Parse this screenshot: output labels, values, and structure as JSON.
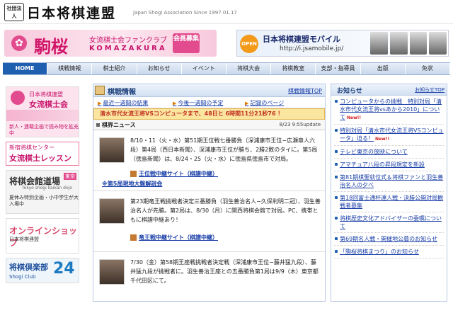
{
  "header": {
    "logo_mark": "社団法人",
    "title": "日本将棋連盟",
    "subtitle": "Japan Shogi Association  Since 1997.01.17"
  },
  "banners": {
    "komazakura": {
      "name": "駒桜",
      "tagline": "女流棋士会ファンクラブ",
      "english": "KOMAZAKURA",
      "button": "会員募集"
    },
    "mobile": {
      "badge": "OPEN",
      "title": "日本将棋連盟モバイル",
      "url": "http://i.jsamobile.jp/"
    }
  },
  "nav": [
    "HOME",
    "棋戦情報",
    "棋士紹介",
    "お知らせ",
    "イベント",
    "将棋大会",
    "将棋教室",
    "支部・指導員",
    "出版",
    "免状"
  ],
  "left": {
    "joryu": {
      "line1": "日本将棋連盟",
      "line2": "女流棋士会",
      "line3": "新人・連載企画で読み物を拡充中"
    },
    "lesson": {
      "line1": "新宿将棋センター",
      "line2": "女流棋士レッスン倶楽部"
    },
    "kaikan": {
      "title": "将棋会館道場",
      "tag": "東京",
      "en": "Tokyo shogi kaikan dojo",
      "desc": "夏休み特別企画・小中学生が大入場中"
    },
    "shop": {
      "title": "オンラインショップ",
      "sub": "日本将棋連盟"
    },
    "club": {
      "title": "将棋倶楽部",
      "number": "24",
      "sub": "Shogi Club"
    }
  },
  "main": {
    "title": "棋戦情報",
    "top_link": "棋戦情報TOP",
    "links": [
      "最近一週間の結果",
      "今後一週間の予定",
      "記録のページ"
    ],
    "countdown": "清水市代女流王将VSコンピュータまで、48日と 6時間11分21秒76 ！",
    "news_title": "棋界ニュース",
    "update": "8/23   9:55update",
    "items": [
      {
        "text": "8/10・11（火・水）第51期王位戦七番勝負（深浦康市王位−広瀬章人六段）第4局（西日本新聞）、深浦康市王位が勝ち、2勝2敗のタイに。第5局（徳島新聞）は、8/24・25（火・水）に徳島県徳島市で対局。",
        "link1": "王位戦中継サイト（棋譜中継）",
        "link2": "※第5局現地大盤解説会"
      },
      {
        "text": "第23期竜王戦挑戦者決定三番勝負（羽生善治名人−久保利明二冠）、羽生善治名人が先勝。第2局は、8/30（月）に関西将棋会館で対局。PC、携帯ともに棋譜中継あり！",
        "link1": "竜王戦中継サイト（棋譜中継）"
      },
      {
        "text": "7/30（金）第58期王座戦挑戦者決定戦（深浦康市王位−藤井猛九段）、藤井猛九段が挑戦者に。羽生善治王座との五番勝負第1局は9/9（木）東京都千代田区にて。"
      }
    ]
  },
  "right": {
    "title": "お知らせ",
    "top_link": "お知らせTOP",
    "items": [
      {
        "text": "コンピュータからの挑戦　特別対局「清水市代女流王将vsあから2010」について",
        "new": "New!!"
      },
      {
        "text": "特別対局「清水市代女流王将VSコンピュータ」迫る！",
        "new": "New!!"
      },
      {
        "text": "テレビ東京の放映について"
      },
      {
        "text": "アマチュア八段の昇段規定を新設"
      },
      {
        "text": "第81期棋聖就位式＆将棋ファンと羽生善治名人の夕べ"
      },
      {
        "text": "第18回富士通杯達人戦・決勝公開対局観戦者募集"
      },
      {
        "text": "将棋歴史文化アドバイザーの委嘱について"
      },
      {
        "text": "第69期名人戦・開催地公募のお知らせ"
      },
      {
        "text": "「駒桜将棋まつり」のお知らせ"
      }
    ]
  }
}
